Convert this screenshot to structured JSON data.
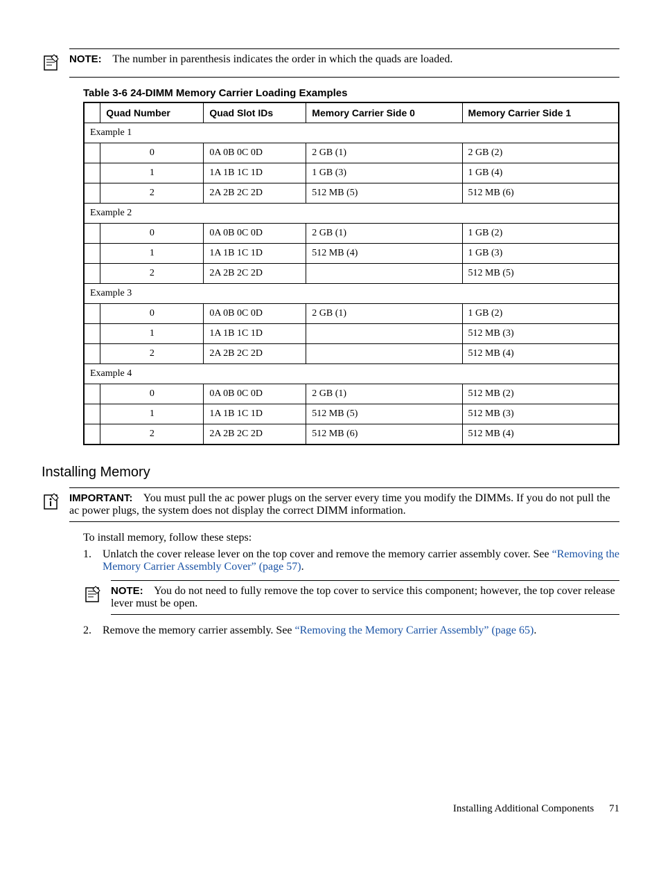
{
  "top_note": {
    "label": "NOTE:",
    "text": "The number in parenthesis indicates the order in which the quads are loaded."
  },
  "table": {
    "caption": "Table  3-6  24-DIMM Memory Carrier Loading Examples",
    "headers": [
      "",
      "Quad Number",
      "Quad Slot IDs",
      "Memory Carrier Side 0",
      "Memory Carrier Side 1"
    ],
    "groups": [
      {
        "label": "Example 1",
        "rows": [
          {
            "quad": "0",
            "slots": "0A 0B 0C 0D",
            "side0": "2 GB (1)",
            "side1": "2 GB (2)"
          },
          {
            "quad": "1",
            "slots": "1A 1B 1C 1D",
            "side0": "1 GB (3)",
            "side1": "1 GB (4)"
          },
          {
            "quad": "2",
            "slots": "2A 2B 2C 2D",
            "side0": "512 MB (5)",
            "side1": "512 MB (6)"
          }
        ]
      },
      {
        "label": "Example 2",
        "rows": [
          {
            "quad": "0",
            "slots": "0A 0B 0C 0D",
            "side0": "2 GB (1)",
            "side1": "1 GB (2)"
          },
          {
            "quad": "1",
            "slots": "1A 1B 1C 1D",
            "side0": "512 MB (4)",
            "side1": "1 GB (3)"
          },
          {
            "quad": "2",
            "slots": "2A 2B 2C 2D",
            "side0": "",
            "side1": "512 MB (5)"
          }
        ]
      },
      {
        "label": "Example 3",
        "rows": [
          {
            "quad": "0",
            "slots": "0A 0B 0C 0D",
            "side0": "2 GB (1)",
            "side1": "1 GB (2)"
          },
          {
            "quad": "1",
            "slots": "1A 1B 1C 1D",
            "side0": "",
            "side1": "512 MB (3)"
          },
          {
            "quad": "2",
            "slots": "2A 2B 2C 2D",
            "side0": "",
            "side1": "512 MB (4)"
          }
        ]
      },
      {
        "label": "Example 4",
        "rows": [
          {
            "quad": "0",
            "slots": "0A 0B 0C 0D",
            "side0": "2 GB (1)",
            "side1": "512 MB (2)"
          },
          {
            "quad": "1",
            "slots": "1A 1B 1C 1D",
            "side0": "512 MB (5)",
            "side1": "512 MB (3)"
          },
          {
            "quad": "2",
            "slots": "2A 2B 2C 2D",
            "side0": "512 MB (6)",
            "side1": "512 MB (4)"
          }
        ]
      }
    ]
  },
  "section_heading": "Installing Memory",
  "important": {
    "label": "IMPORTANT:",
    "text": "You must pull the ac power plugs on the server every time you modify the DIMMs. If you do not pull the ac power plugs, the system does not display the correct DIMM information."
  },
  "intro": "To install memory, follow these steps:",
  "steps": {
    "s1": {
      "num": "1.",
      "pre": "Unlatch the cover release lever on the top cover and remove the memory carrier assembly cover. See ",
      "link": "“Removing the Memory Carrier Assembly Cover” (page 57)",
      "post": "."
    },
    "s2": {
      "num": "2.",
      "pre": "Remove the memory carrier assembly. See ",
      "link": "“Removing the Memory Carrier Assembly” (page 65)",
      "post": "."
    }
  },
  "mid_note": {
    "label": "NOTE:",
    "text": "You do not need to fully remove the top cover to service this component; however, the top cover release lever must be open."
  },
  "footer": {
    "text": "Installing Additional Components",
    "page": "71"
  }
}
